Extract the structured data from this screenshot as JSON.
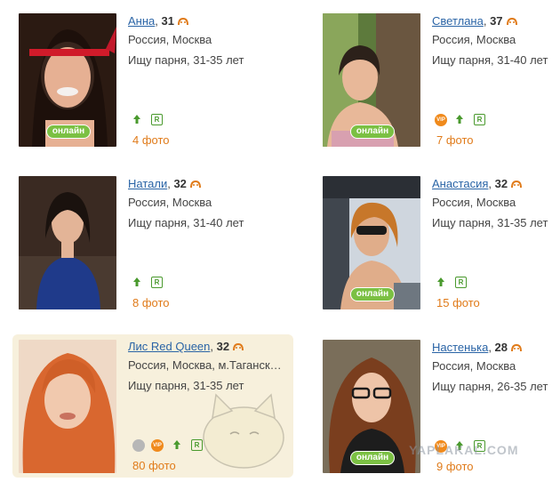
{
  "profiles": [
    {
      "name": "Анна",
      "age": "31",
      "location": "Россия, Москва",
      "seeking": "Ищу парня, 31-35 лет",
      "photos": "4 фото",
      "online": "онлайн"
    },
    {
      "name": "Светлана",
      "age": "37",
      "location": "Россия, Москва",
      "seeking": "Ищу парня, 31-40 лет",
      "photos": "7 фото",
      "online": "онлайн"
    },
    {
      "name": "Натали",
      "age": "32",
      "location": "Россия, Москва",
      "seeking": "Ищу парня, 31-40 лет",
      "photos": "8 фото"
    },
    {
      "name": "Анастасия",
      "age": "32",
      "location": "Россия, Москва",
      "seeking": "Ищу парня, 31-35 лет",
      "photos": "15 фото",
      "online": "онлайн"
    },
    {
      "name": "Лис Red Queen",
      "age": "32",
      "location": "Россия, Москва, м.Таганск…",
      "seeking": "Ищу парня, 31-35 лет",
      "photos": "80 фото"
    },
    {
      "name": "Настенька",
      "age": "28",
      "location": "Россия, Москва",
      "seeking": "Ищу парня, 26-35 лет",
      "photos": "9 фото",
      "online": "онлайн"
    }
  ],
  "badges": {
    "r": "R",
    "vip": "VIP"
  },
  "watermark": "YAPLAKAL.COM",
  "colors": {
    "link": "#2a64a6",
    "photos": "#e07b1a",
    "online": "#7bc043",
    "highlight": "#f7f0dc"
  }
}
